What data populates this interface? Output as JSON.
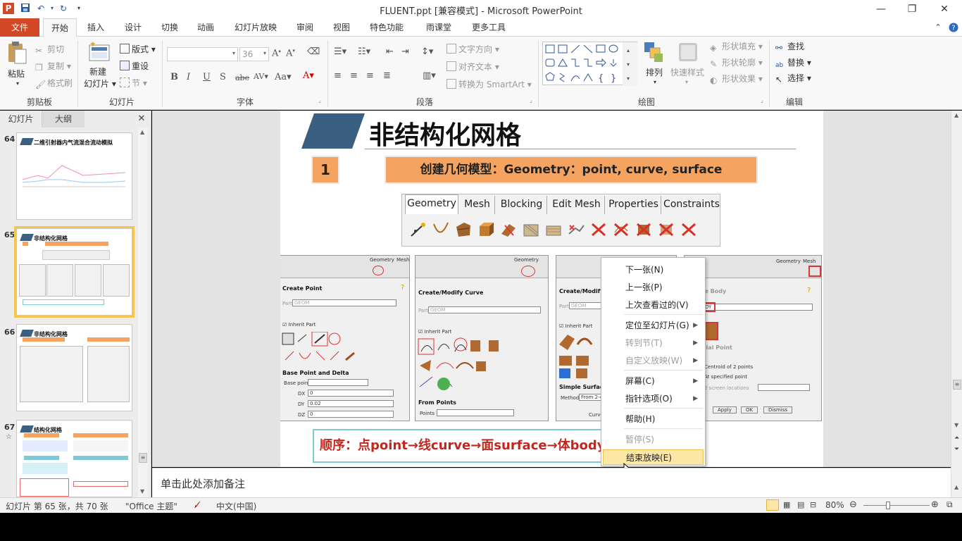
{
  "window": {
    "title": "FLUENT.ppt [兼容模式]  -  Microsoft PowerPoint",
    "controls": {
      "minimize": "—",
      "restore": "❐",
      "close": "✕"
    }
  },
  "ribbon_tabs": [
    "文件",
    "开始",
    "插入",
    "设计",
    "切换",
    "动画",
    "幻灯片放映",
    "审阅",
    "视图",
    "特色功能",
    "雨课堂",
    "更多工具"
  ],
  "ribbon": {
    "clipboard": {
      "paste": "粘贴",
      "cut": "剪切",
      "copy": "复制",
      "format_painter": "格式刷",
      "label": "剪贴板"
    },
    "slides": {
      "new_slide_1": "新建",
      "new_slide_2": "幻灯片",
      "layout": "版式",
      "reset": "重设",
      "section": "节",
      "label": "幻灯片"
    },
    "font": {
      "size": "36",
      "label": "字体"
    },
    "paragraph": {
      "text_direction": "文字方向",
      "align_text": "对齐文本",
      "smartart": "转换为 SmartArt",
      "label": "段落"
    },
    "drawing": {
      "arrange": "排列",
      "quick_styles": "快速样式",
      "shape_fill": "形状填充",
      "shape_outline": "形状轮廓",
      "shape_effects": "形状效果",
      "label": "绘图"
    },
    "editing": {
      "find": "查找",
      "replace": "替换",
      "select": "选择",
      "label": "编辑"
    }
  },
  "left_panel": {
    "tabs": [
      "幻灯片",
      "大纲"
    ],
    "thumbnails": [
      {
        "num": "64",
        "title": "二维引射器内气流混合流动模拟"
      },
      {
        "num": "65",
        "title": "非结构化网格"
      },
      {
        "num": "66",
        "title": "非结构化网格"
      },
      {
        "num": "67",
        "title": "结构化网格"
      }
    ]
  },
  "slide": {
    "title": "非结构化网格",
    "step_num": "1",
    "banner": "创建几何模型：Geometry：point, curve, surface",
    "icon_tabs": [
      "Geometry",
      "Mesh",
      "Blocking",
      "Edit Mesh",
      "Properties",
      "Constraints"
    ],
    "panels": [
      {
        "title": "Create Point",
        "part_label": "Part",
        "part_value": "GEOM",
        "inherit": "Inherit Part",
        "section": "Base Point and Delta",
        "base_point": "Base point",
        "dx": "DX",
        "dy": "DY",
        "dz": "DZ",
        "dx_val": "0",
        "dy_val": "0.02",
        "dz_val": "0"
      },
      {
        "title": "Create/Modify Curve",
        "part_label": "Part",
        "part_value": "GEOM",
        "inherit": "Inherit Part",
        "section": "From Points",
        "points": "Points"
      },
      {
        "title": "Create/Modify Su",
        "part_label": "Part",
        "part_value": "GEOM",
        "inherit": "Inherit Part",
        "section": "Simple Surface",
        "method_label": "Method",
        "method_value": "From 2-4 C",
        "curves": "Curves"
      },
      {
        "title": "Create Body",
        "part_value": "DY",
        "section": "Material Point",
        "centroid": "Centroid of 2 points",
        "specified": "At specified point",
        "locations": "2 screen locations",
        "apply": "Apply",
        "ok": "OK",
        "dismiss": "Dismiss",
        "toolbar_tab1": "Geometry",
        "toolbar_tab2": "Mesh"
      }
    ],
    "sequence": "顺序：点point→线curve→面surface→体body"
  },
  "context_menu": [
    {
      "label": "下一张(N)",
      "enabled": true
    },
    {
      "label": "上一张(P)",
      "enabled": true
    },
    {
      "label": "上次查看过的(V)",
      "enabled": true
    },
    {
      "label": "定位至幻灯片(G)",
      "enabled": true,
      "submenu": true
    },
    {
      "label": "转到节(T)",
      "enabled": false,
      "submenu": true
    },
    {
      "label": "自定义放映(W)",
      "enabled": false,
      "submenu": true
    },
    {
      "label": "屏幕(C)",
      "enabled": true,
      "submenu": true
    },
    {
      "label": "指针选项(O)",
      "enabled": true,
      "submenu": true
    },
    {
      "label": "帮助(H)",
      "enabled": true
    },
    {
      "label": "暂停(S)",
      "enabled": false
    },
    {
      "label": "结束放映(E)",
      "enabled": true,
      "highlighted": true
    }
  ],
  "notes_placeholder": "单击此处添加备注",
  "status_bar": {
    "slide_info": "幻灯片 第 65 张，共 70 张",
    "theme": "\"Office 主题\"",
    "language": "中文(中国)",
    "zoom": "80%"
  },
  "colors": {
    "accent_file": "#d24726",
    "banner": "#f4a460",
    "title_bar_shape": "#3a5f80",
    "highlight": "#fde7a6",
    "sequence_text": "#c0281f"
  }
}
